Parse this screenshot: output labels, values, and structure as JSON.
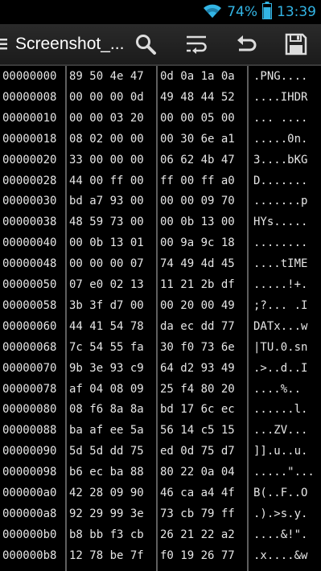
{
  "status_bar": {
    "battery_percent": "74%",
    "time": "13:39",
    "icons": [
      "wifi-icon",
      "battery-icon"
    ]
  },
  "action_bar": {
    "title": "Screenshot_...",
    "actions": [
      "search-icon",
      "wrap-lines-icon",
      "undo-icon",
      "save-icon"
    ]
  },
  "hex_rows": [
    {
      "addr": "00000000",
      "g1": "89 50 4e 47",
      "g2": "0d 0a 1a 0a",
      "ascii": ".PNG...."
    },
    {
      "addr": "00000008",
      "g1": "00 00 00 0d",
      "g2": "49 48 44 52",
      "ascii": "....IHDR"
    },
    {
      "addr": "00000010",
      "g1": "00 00 03 20",
      "g2": "00 00 05 00",
      "ascii": "... ...."
    },
    {
      "addr": "00000018",
      "g1": "08 02 00 00",
      "g2": "00 30 6e a1",
      "ascii": ".....0n."
    },
    {
      "addr": "00000020",
      "g1": "33 00 00 00",
      "g2": "06 62 4b 47",
      "ascii": "3....bKG"
    },
    {
      "addr": "00000028",
      "g1": "44 00 ff 00",
      "g2": "ff 00 ff a0",
      "ascii": "D......."
    },
    {
      "addr": "00000030",
      "g1": "bd a7 93 00",
      "g2": "00 00 09 70",
      "ascii": ".......p"
    },
    {
      "addr": "00000038",
      "g1": "48 59 73 00",
      "g2": "00 0b 13 00",
      "ascii": "HYs....."
    },
    {
      "addr": "00000040",
      "g1": "00 0b 13 01",
      "g2": "00 9a 9c 18",
      "ascii": "........"
    },
    {
      "addr": "00000048",
      "g1": "00 00 00 07",
      "g2": "74 49 4d 45",
      "ascii": "....tIME"
    },
    {
      "addr": "00000050",
      "g1": "07 e0 02 13",
      "g2": "11 21 2b df",
      "ascii": ".....!+."
    },
    {
      "addr": "00000058",
      "g1": "3b 3f d7 00",
      "g2": "00 20 00 49",
      "ascii": ";?... .I"
    },
    {
      "addr": "00000060",
      "g1": "44 41 54 78",
      "g2": "da ec dd 77",
      "ascii": "DATx...w"
    },
    {
      "addr": "00000068",
      "g1": "7c 54 55 fa",
      "g2": "30 f0 73 6e",
      "ascii": "|TU.0.sn"
    },
    {
      "addr": "00000070",
      "g1": "9b 3e 93 c9",
      "g2": "64 d2 93 49",
      "ascii": ".>..d..I"
    },
    {
      "addr": "00000078",
      "g1": "af 04 08 09",
      "g2": "25 f4 80 20",
      "ascii": "....%.. "
    },
    {
      "addr": "00000080",
      "g1": "08 f6 8a 8a",
      "g2": "bd 17 6c ec",
      "ascii": "......l."
    },
    {
      "addr": "00000088",
      "g1": "ba af ee 5a",
      "g2": "56 14 c5 15",
      "ascii": "...ZV..."
    },
    {
      "addr": "00000090",
      "g1": "5d 5d dd 75",
      "g2": "ed 0d 75 d7",
      "ascii": "]].u..u."
    },
    {
      "addr": "00000098",
      "g1": "b6 ec ba 88",
      "g2": "80 22 0a 04",
      "ascii": ".....\"..."
    },
    {
      "addr": "000000a0",
      "g1": "42 28 09 90",
      "g2": "46 ca a4 4f",
      "ascii": "B(..F..O"
    },
    {
      "addr": "000000a8",
      "g1": "92 29 99 3e",
      "g2": "73 cb 79 ff",
      "ascii": ".).>s.y."
    },
    {
      "addr": "000000b0",
      "g1": "b8 bb f3 cb",
      "g2": "26 21 22 a2",
      "ascii": "....&!\"."
    },
    {
      "addr": "000000b8",
      "g1": "12 78 be 7f",
      "g2": "f0 19 26 77",
      "ascii": ".x....&w"
    }
  ]
}
